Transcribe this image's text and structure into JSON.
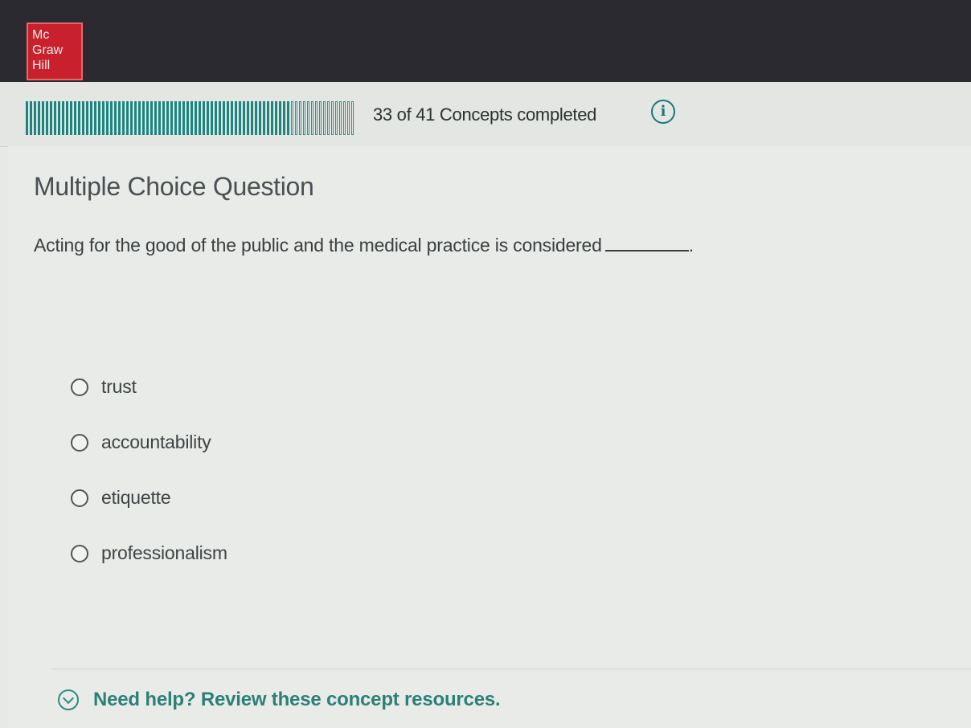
{
  "brand": {
    "logo_lines": [
      "Mc",
      "Graw",
      "Hill"
    ],
    "logo_color": "#c8202c"
  },
  "progress": {
    "completed": 33,
    "total": 41,
    "label": "33 of 41 Concepts completed",
    "info_icon": "info-icon"
  },
  "question": {
    "type": "Multiple Choice Question",
    "text": "Acting for the good of the public and the medical practice is considered",
    "blank_suffix": ".",
    "options": [
      {
        "label": "trust",
        "selected": false
      },
      {
        "label": "accountability",
        "selected": false
      },
      {
        "label": "etiquette",
        "selected": false
      },
      {
        "label": "professionalism",
        "selected": false
      }
    ]
  },
  "help": {
    "icon": "chevron-down-circle-icon",
    "text": "Need help? Review these concept resources."
  },
  "colors": {
    "accent": "#1d8580",
    "header": "#2c2a31",
    "help_text": "#2d7f78"
  }
}
